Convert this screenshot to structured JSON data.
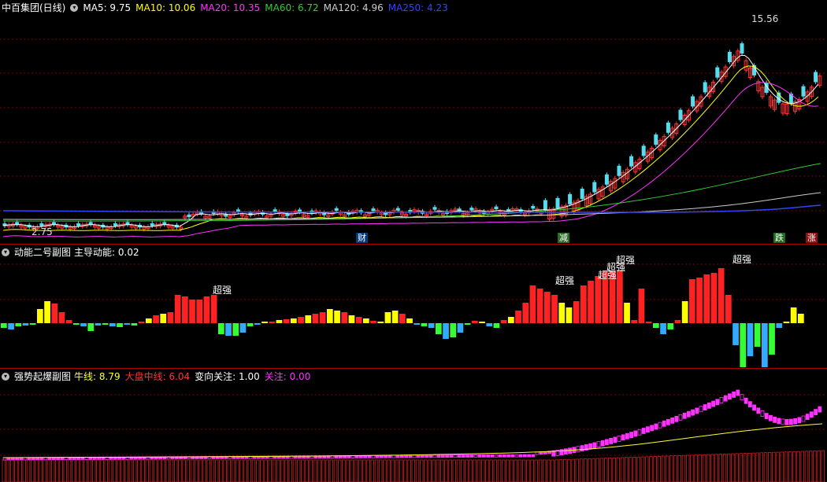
{
  "main": {
    "title": "中百集团(日线)",
    "ma": [
      {
        "label": "MA5: 9.75",
        "color": "#ffffff"
      },
      {
        "label": "MA10: 10.06",
        "color": "#ffff00"
      },
      {
        "label": "MA20: 10.35",
        "color": "#ff33ff"
      },
      {
        "label": "MA60: 6.72",
        "color": "#33cc33"
      },
      {
        "label": "MA120: 4.96",
        "color": "#cccccc"
      },
      {
        "label": "MA250: 4.23",
        "color": "#3344ff"
      }
    ],
    "high_label": "15.56",
    "low_label": "2.75",
    "tags": [
      {
        "text": "财",
        "color": "#ffffff",
        "bg": "#003b7a"
      },
      {
        "text": "减",
        "color": "#ffffff",
        "bg": "#2b6b2b"
      },
      {
        "text": "跌",
        "color": "#ffffff",
        "bg": "#1f6b1f"
      },
      {
        "text": "涨",
        "color": "#ffffff",
        "bg": "#8a1111"
      }
    ]
  },
  "panel2": {
    "title": "动能二号副图",
    "label": "主导动能: 0.02",
    "annotations": [
      "超强",
      "超强",
      "超强",
      "超强",
      "超强",
      "超强"
    ]
  },
  "panel3": {
    "title": "强势起爆副图",
    "items": [
      {
        "label": "牛线: 8.79",
        "color": "#ffff33"
      },
      {
        "label": "大盘中线: 6.04",
        "color": "#ff3333"
      },
      {
        "label": "变向关注: 1.00",
        "color": "#ffffff"
      },
      {
        "label": "关注: 0.00",
        "color": "#ff33ff"
      }
    ]
  },
  "colors": {
    "up": "#ff3333",
    "down": "#55ddee",
    "grid": "#7a0000"
  }
}
